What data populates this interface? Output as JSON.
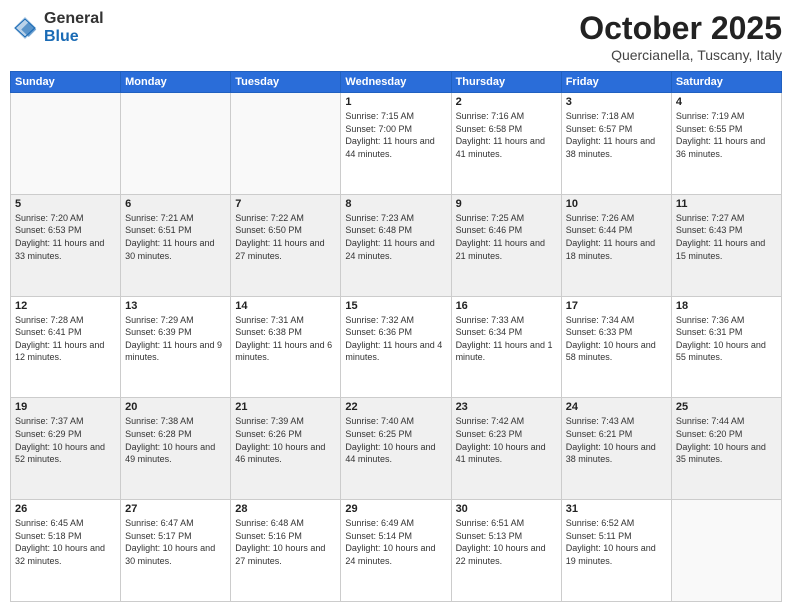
{
  "logo": {
    "general": "General",
    "blue": "Blue"
  },
  "title": "October 2025",
  "location": "Quercianella, Tuscany, Italy",
  "weekdays": [
    "Sunday",
    "Monday",
    "Tuesday",
    "Wednesday",
    "Thursday",
    "Friday",
    "Saturday"
  ],
  "weeks": [
    [
      {
        "day": "",
        "info": ""
      },
      {
        "day": "",
        "info": ""
      },
      {
        "day": "",
        "info": ""
      },
      {
        "day": "1",
        "info": "Sunrise: 7:15 AM\nSunset: 7:00 PM\nDaylight: 11 hours and 44 minutes."
      },
      {
        "day": "2",
        "info": "Sunrise: 7:16 AM\nSunset: 6:58 PM\nDaylight: 11 hours and 41 minutes."
      },
      {
        "day": "3",
        "info": "Sunrise: 7:18 AM\nSunset: 6:57 PM\nDaylight: 11 hours and 38 minutes."
      },
      {
        "day": "4",
        "info": "Sunrise: 7:19 AM\nSunset: 6:55 PM\nDaylight: 11 hours and 36 minutes."
      }
    ],
    [
      {
        "day": "5",
        "info": "Sunrise: 7:20 AM\nSunset: 6:53 PM\nDaylight: 11 hours and 33 minutes."
      },
      {
        "day": "6",
        "info": "Sunrise: 7:21 AM\nSunset: 6:51 PM\nDaylight: 11 hours and 30 minutes."
      },
      {
        "day": "7",
        "info": "Sunrise: 7:22 AM\nSunset: 6:50 PM\nDaylight: 11 hours and 27 minutes."
      },
      {
        "day": "8",
        "info": "Sunrise: 7:23 AM\nSunset: 6:48 PM\nDaylight: 11 hours and 24 minutes."
      },
      {
        "day": "9",
        "info": "Sunrise: 7:25 AM\nSunset: 6:46 PM\nDaylight: 11 hours and 21 minutes."
      },
      {
        "day": "10",
        "info": "Sunrise: 7:26 AM\nSunset: 6:44 PM\nDaylight: 11 hours and 18 minutes."
      },
      {
        "day": "11",
        "info": "Sunrise: 7:27 AM\nSunset: 6:43 PM\nDaylight: 11 hours and 15 minutes."
      }
    ],
    [
      {
        "day": "12",
        "info": "Sunrise: 7:28 AM\nSunset: 6:41 PM\nDaylight: 11 hours and 12 minutes."
      },
      {
        "day": "13",
        "info": "Sunrise: 7:29 AM\nSunset: 6:39 PM\nDaylight: 11 hours and 9 minutes."
      },
      {
        "day": "14",
        "info": "Sunrise: 7:31 AM\nSunset: 6:38 PM\nDaylight: 11 hours and 6 minutes."
      },
      {
        "day": "15",
        "info": "Sunrise: 7:32 AM\nSunset: 6:36 PM\nDaylight: 11 hours and 4 minutes."
      },
      {
        "day": "16",
        "info": "Sunrise: 7:33 AM\nSunset: 6:34 PM\nDaylight: 11 hours and 1 minute."
      },
      {
        "day": "17",
        "info": "Sunrise: 7:34 AM\nSunset: 6:33 PM\nDaylight: 10 hours and 58 minutes."
      },
      {
        "day": "18",
        "info": "Sunrise: 7:36 AM\nSunset: 6:31 PM\nDaylight: 10 hours and 55 minutes."
      }
    ],
    [
      {
        "day": "19",
        "info": "Sunrise: 7:37 AM\nSunset: 6:29 PM\nDaylight: 10 hours and 52 minutes."
      },
      {
        "day": "20",
        "info": "Sunrise: 7:38 AM\nSunset: 6:28 PM\nDaylight: 10 hours and 49 minutes."
      },
      {
        "day": "21",
        "info": "Sunrise: 7:39 AM\nSunset: 6:26 PM\nDaylight: 10 hours and 46 minutes."
      },
      {
        "day": "22",
        "info": "Sunrise: 7:40 AM\nSunset: 6:25 PM\nDaylight: 10 hours and 44 minutes."
      },
      {
        "day": "23",
        "info": "Sunrise: 7:42 AM\nSunset: 6:23 PM\nDaylight: 10 hours and 41 minutes."
      },
      {
        "day": "24",
        "info": "Sunrise: 7:43 AM\nSunset: 6:21 PM\nDaylight: 10 hours and 38 minutes."
      },
      {
        "day": "25",
        "info": "Sunrise: 7:44 AM\nSunset: 6:20 PM\nDaylight: 10 hours and 35 minutes."
      }
    ],
    [
      {
        "day": "26",
        "info": "Sunrise: 6:45 AM\nSunset: 5:18 PM\nDaylight: 10 hours and 32 minutes."
      },
      {
        "day": "27",
        "info": "Sunrise: 6:47 AM\nSunset: 5:17 PM\nDaylight: 10 hours and 30 minutes."
      },
      {
        "day": "28",
        "info": "Sunrise: 6:48 AM\nSunset: 5:16 PM\nDaylight: 10 hours and 27 minutes."
      },
      {
        "day": "29",
        "info": "Sunrise: 6:49 AM\nSunset: 5:14 PM\nDaylight: 10 hours and 24 minutes."
      },
      {
        "day": "30",
        "info": "Sunrise: 6:51 AM\nSunset: 5:13 PM\nDaylight: 10 hours and 22 minutes."
      },
      {
        "day": "31",
        "info": "Sunrise: 6:52 AM\nSunset: 5:11 PM\nDaylight: 10 hours and 19 minutes."
      },
      {
        "day": "",
        "info": ""
      }
    ]
  ]
}
